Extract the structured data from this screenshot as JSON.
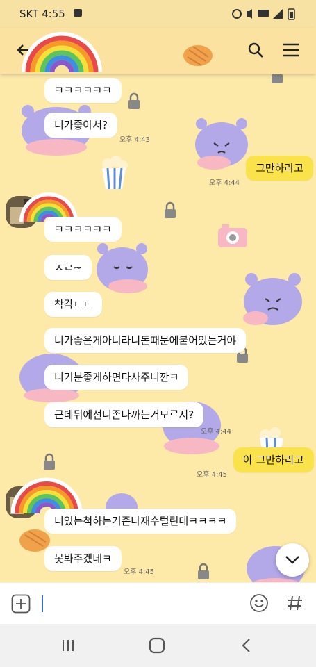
{
  "status_bar": {
    "carrier_time": "SKT 4:55",
    "icons": [
      "image-icon",
      "alarm-icon",
      "mute-icon",
      "5g-icon",
      "signal-icon",
      "battery-icon"
    ]
  },
  "header": {
    "back_icon": "back-arrow-icon",
    "search_icon": "search-icon",
    "menu_icon": "menu-icon"
  },
  "messages": [
    {
      "id": "m1",
      "from": "other",
      "text": "ㅋㅋㅋㅋㅋㅋ",
      "time": ""
    },
    {
      "id": "m2",
      "from": "other",
      "text": "니가좋아서?",
      "time": "오후 4:43"
    },
    {
      "id": "m3",
      "from": "me",
      "text": "그만하라고",
      "time": "오후 4:44"
    },
    {
      "id": "m4",
      "from": "other",
      "text": "ㅋㅋㅋㅋㅋㅋ",
      "time": ""
    },
    {
      "id": "m5",
      "from": "other",
      "text": "ㅈㄹ~",
      "time": ""
    },
    {
      "id": "m6",
      "from": "other",
      "text": "착각ㄴㄴ",
      "time": ""
    },
    {
      "id": "m7",
      "from": "other",
      "text": "니가좋은게아니라니돈때문에붙어있는거야",
      "time": ""
    },
    {
      "id": "m8",
      "from": "other",
      "text": "니기분좋게하면다사주니깐ㅋ",
      "time": ""
    },
    {
      "id": "m9",
      "from": "other",
      "text": "근데뒤에선니존나까는거모르지?",
      "time": "오후 4:44"
    },
    {
      "id": "m10",
      "from": "me",
      "text": "아 그만하라고",
      "time": "오후 4:45"
    },
    {
      "id": "m11",
      "from": "other",
      "text": "니있는척하는거존나재수털린데ㅋㅋㅋㅋ",
      "time": ""
    },
    {
      "id": "m12",
      "from": "other",
      "text": "못봐주겠네ㅋ",
      "time": "오후 4:45"
    }
  ],
  "input_bar": {
    "add_icon": "plus-icon",
    "emoji_icon": "emoji-icon",
    "hash_icon": "hashtag-icon"
  },
  "nav_bar": {
    "recent_icon": "recent-apps-icon",
    "home_icon": "home-icon",
    "back_icon": "back-icon"
  },
  "scroll_icon": "chevron-down-icon",
  "colors": {
    "background": "#fde9a8",
    "my_bubble": "#fae34a",
    "other_bubble": "#ffffff",
    "header": "#fbe2a0"
  }
}
